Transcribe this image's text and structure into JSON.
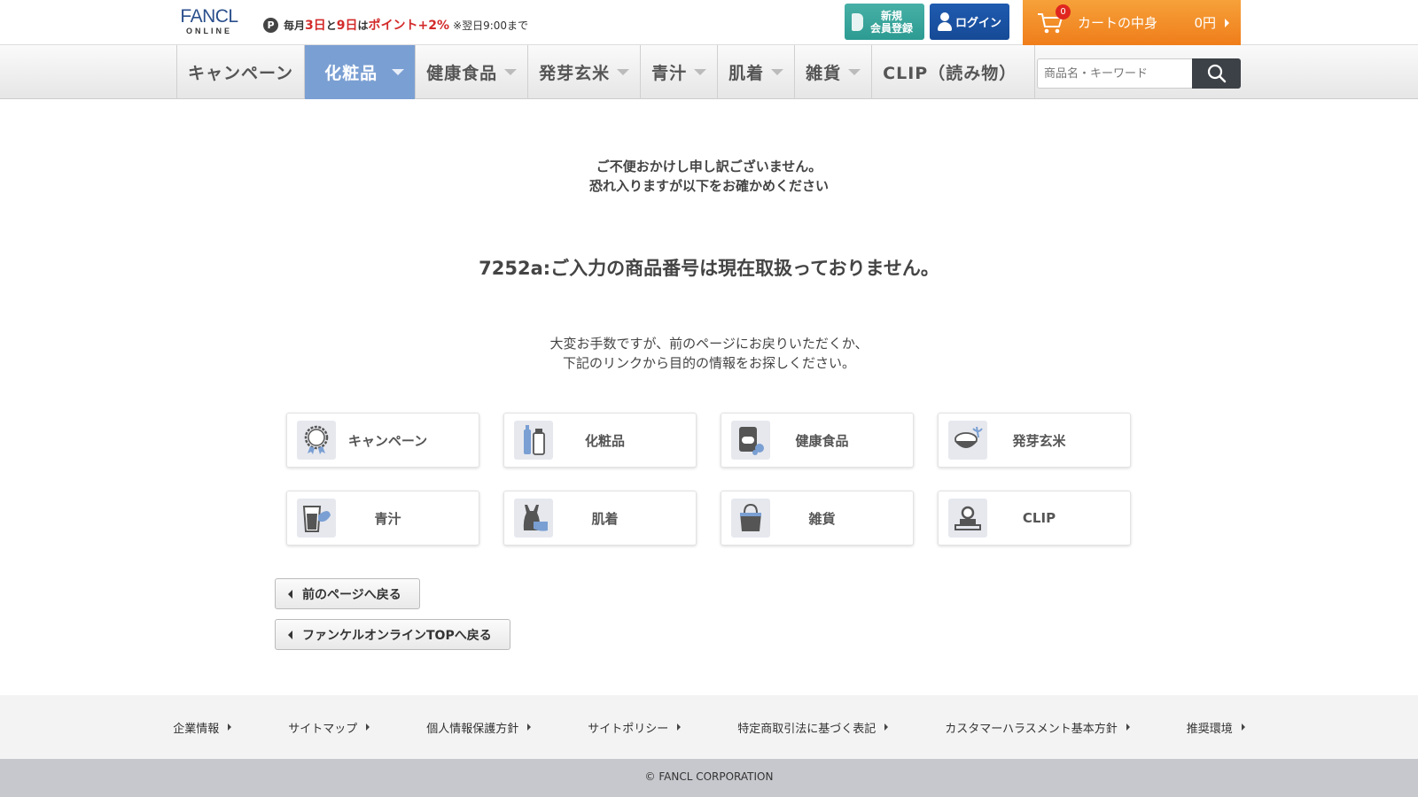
{
  "header": {
    "logo_main": "FANCL",
    "logo_sub": "ONLINE",
    "promo": {
      "p_mark": "P",
      "part1": "毎月",
      "day1": "3日",
      "part2": "と",
      "day2": "9日",
      "part3": "は",
      "points": "ポイント+2%",
      "note": "※翌日9:00まで"
    },
    "register_label_line1": "新規",
    "register_label_line2": "会員登録",
    "login_label": "ログイン",
    "cart_label": "カートの中身",
    "cart_amount": "0円",
    "cart_count": "0"
  },
  "nav": {
    "items": [
      {
        "label": "キャンペーン"
      },
      {
        "label": "化粧品"
      },
      {
        "label": "健康食品"
      },
      {
        "label": "発芽玄米"
      },
      {
        "label": "青汁"
      },
      {
        "label": "肌着"
      },
      {
        "label": "雑貨"
      },
      {
        "label": "CLIP（読み物）"
      }
    ],
    "active": "化粧品",
    "search_placeholder": "商品名・キーワード"
  },
  "main": {
    "apology_line1": "ご不便おかけし申し訳ございません。",
    "apology_line2": "恐れ入りますが以下をお確かめください",
    "error_message": "7252a:ご入力の商品番号は現在取扱っておりません。",
    "guide_line1": "大変お手数ですが、前のページにお戻りいただくか、",
    "guide_line2": "下記のリンクから目的の情報をお探しください。",
    "categories": [
      {
        "label": "キャンペーン",
        "icon": "campaign-badge-icon"
      },
      {
        "label": "化粧品",
        "icon": "cosmetics-bottle-icon"
      },
      {
        "label": "健康食品",
        "icon": "supplement-package-icon"
      },
      {
        "label": "発芽玄米",
        "icon": "rice-bowl-icon"
      },
      {
        "label": "青汁",
        "icon": "green-juice-glass-icon"
      },
      {
        "label": "肌着",
        "icon": "underwear-icon"
      },
      {
        "label": "雑貨",
        "icon": "tote-bag-icon"
      },
      {
        "label": "CLIP",
        "icon": "clip-stamp-icon"
      }
    ],
    "back_previous": "前のページへ戻る",
    "back_top": "ファンケルオンラインTOPへ戻る"
  },
  "footer": {
    "links": [
      {
        "label": "企業情報"
      },
      {
        "label": "サイトマップ"
      },
      {
        "label": "個人情報保護方針"
      },
      {
        "label": "サイトポリシー"
      },
      {
        "label": "特定商取引法に基づく表記"
      },
      {
        "label": "カスタマーハラスメント基本方針"
      },
      {
        "label": "推奨環境"
      }
    ],
    "copyright": "© FANCL CORPORATION"
  },
  "colors": {
    "brand_blue": "#2b4f8c",
    "nav_active": "#7a9fd3",
    "register_green": "#2c9b92",
    "login_blue": "#1f5bb0",
    "cart_orange": "#ef7d1a",
    "promo_red": "#d32a2a"
  }
}
